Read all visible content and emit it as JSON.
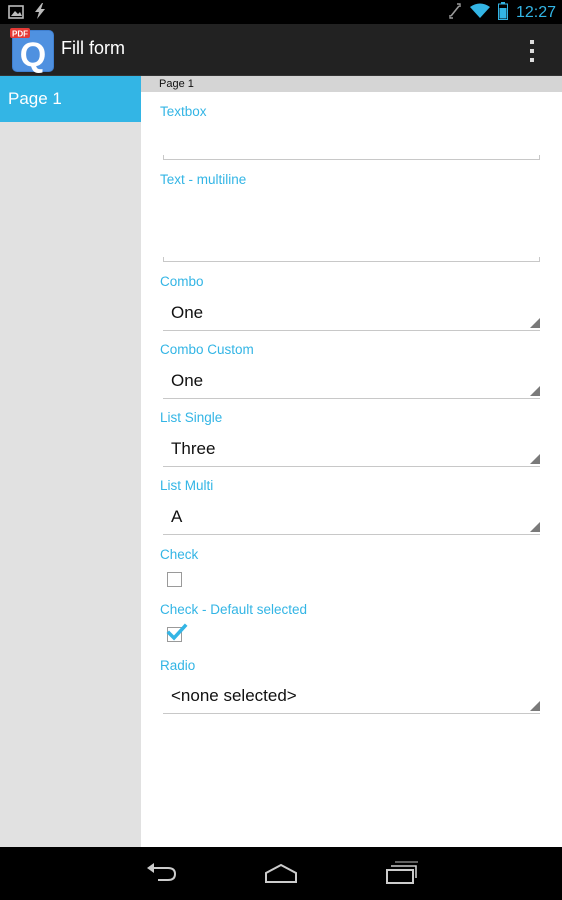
{
  "status_bar": {
    "time": "12:27",
    "icons": [
      "picture-icon",
      "lightning-icon",
      "mute-icon",
      "wifi-icon",
      "battery-icon"
    ]
  },
  "action_bar": {
    "app_icon": {
      "badge": "PDF",
      "letter": "Q"
    },
    "title": "Fill form",
    "overflow_icon": "overflow-menu-icon"
  },
  "sidebar": {
    "items": [
      {
        "label": "Page 1",
        "selected": true
      }
    ]
  },
  "main": {
    "page_header": "Page 1",
    "fields": {
      "textbox": {
        "label": "Textbox",
        "value": ""
      },
      "text_multiline": {
        "label": "Text - multiline",
        "value": ""
      },
      "combo": {
        "label": "Combo",
        "value": "One"
      },
      "combo_custom": {
        "label": "Combo Custom",
        "value": "One"
      },
      "list_single": {
        "label": "List Single",
        "value": "Three"
      },
      "list_multi": {
        "label": "List Multi",
        "value": "A"
      },
      "check": {
        "label": "Check",
        "checked": false
      },
      "check_default": {
        "label": "Check - Default selected",
        "checked": true
      },
      "radio": {
        "label": "Radio",
        "value": "<none selected>"
      }
    }
  },
  "nav_bar": {
    "icons": [
      "back-icon",
      "home-icon",
      "recents-icon"
    ]
  },
  "colors": {
    "accent": "#33b5e5",
    "actionbar": "#222222",
    "sidebar": "#e1e1e1"
  }
}
